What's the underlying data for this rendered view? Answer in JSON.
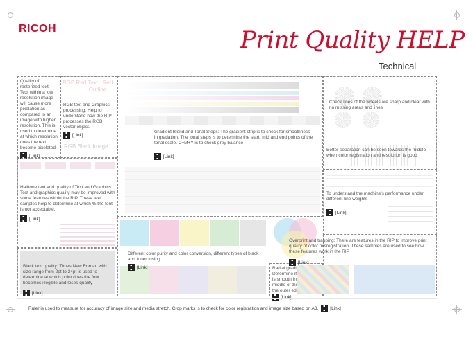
{
  "header": {
    "logo": "RICOH",
    "title": "Print Quality HELP",
    "subtitle": "Technical"
  },
  "sections": {
    "rasterized": {
      "text": "Quality of rasterized text: Text within a low resolution image will cause more pixelation as compared to an image with higher resolution. This is used to determine at which resolution does the text become pixelated",
      "link": "[Link]"
    },
    "rgb": {
      "text": "RGB text and Graphics processing: Help to understand how the RIP processes the RGB vector object.",
      "link": "[Link]"
    },
    "gradient": {
      "text": "Gradient Blend and Tonal Steps: The gradient strip is to check for smoothness in gradation. The tonal steps is to determine the start, mid and end points of the tonal scale. C+M+Y is to check grey balance",
      "link": "[Link]"
    },
    "wheels": {
      "text": "Check lines of the wheels are sharp and clear with no missing areas and lines"
    },
    "separation": {
      "text": "Better separation can be seen towards the middle when color registration and resolution is good"
    },
    "halftone": {
      "text": "Halftone text and quality of Text and Graphics: Text and graphics quality may be improved with some features within the RIP. These text samples help to determine at which % the font is not acceptable.",
      "link": "[Link]"
    },
    "lineweights": {
      "text": "To understand the machine's performance under different line weights",
      "link": "[Link]"
    },
    "purity": {
      "text": "Different color purity and color conversion, different types of black and toner fusing",
      "link": "[Link]"
    },
    "overprint": {
      "text": "Overprint and trapping: There are features in the RIP to improve print quality of color misregistration. These samples are used to see how these features work in the RIP",
      "link": "[Link]"
    },
    "blacktext": {
      "text": "Black text quality: Times New Roman with size range from 2pt to 24pt is used to determine at which point does the font becomes illegible and loses quality",
      "link": "[Link]"
    },
    "radial": {
      "text": "Radial gradients: Determine if the gradient is smooth from the middle of the circle to the outer edge",
      "link": "[Link]"
    }
  },
  "footer": {
    "text": "Ruler is used to measure for accuracy of image size and media stretch. Crop marks is to check for color registration and image size based on A3.",
    "link": "[Link]"
  }
}
